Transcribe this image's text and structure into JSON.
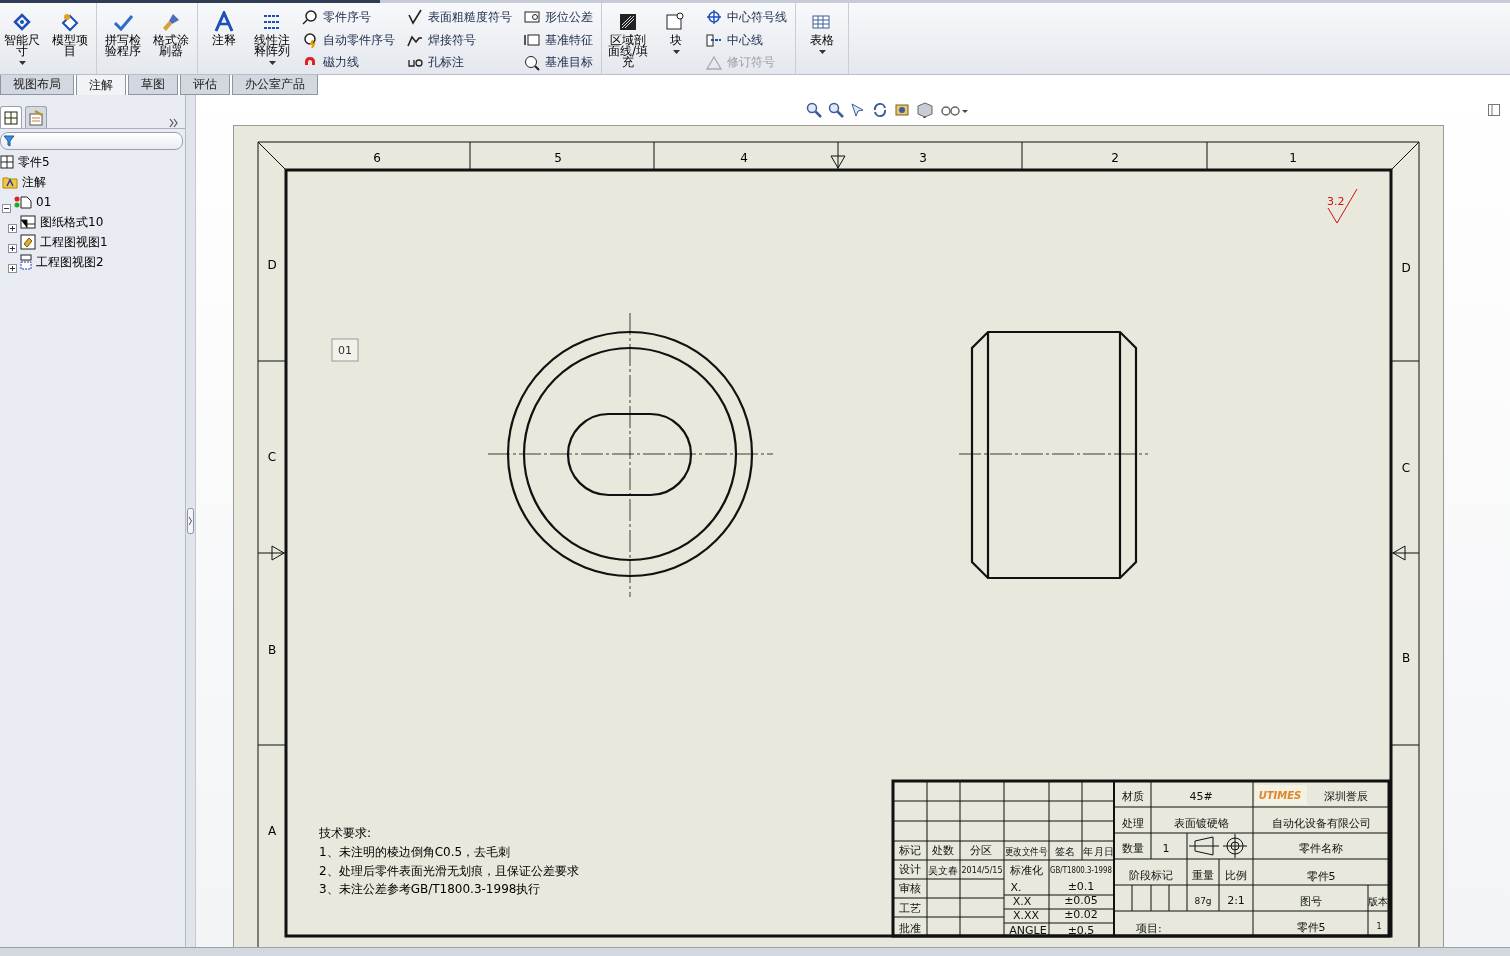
{
  "ribbon": [
    {
      "columns": [
        {
          "kind": "large",
          "label": "智能尺寸",
          "menu": true
        },
        {
          "kind": "large",
          "label": "模型项目",
          "menu": false
        }
      ]
    },
    {
      "columns": [
        {
          "kind": "large",
          "label": "拼写检验程序",
          "menu": false
        },
        {
          "kind": "large",
          "label": "格式涂刷器",
          "menu": false
        }
      ]
    },
    {
      "columns": [
        {
          "kind": "large",
          "label": "注释",
          "menu": false
        },
        {
          "kind": "large",
          "label": "线性注释阵列",
          "menu": true
        },
        {
          "kind": "stack",
          "buttons": [
            {
              "label": "零件序号",
              "disabled": false
            },
            {
              "label": "自动零件序号",
              "disabled": false
            },
            {
              "label": "磁力线",
              "disabled": false
            }
          ]
        },
        {
          "kind": "stack",
          "buttons": [
            {
              "label": "表面粗糙度符号",
              "disabled": false
            },
            {
              "label": "焊接符号",
              "disabled": false
            },
            {
              "label": "孔标注",
              "disabled": false
            }
          ]
        },
        {
          "kind": "stack",
          "buttons": [
            {
              "label": "形位公差",
              "disabled": false
            },
            {
              "label": "基准特征",
              "disabled": false
            },
            {
              "label": "基准目标",
              "disabled": false
            }
          ]
        }
      ]
    },
    {
      "columns": [
        {
          "kind": "large",
          "label": "区域剖面线/填充",
          "menu": false
        },
        {
          "kind": "large",
          "label": "块",
          "menu": true
        },
        {
          "kind": "stack",
          "buttons": [
            {
              "label": "中心符号线",
              "disabled": false
            },
            {
              "label": "中心线",
              "disabled": false
            },
            {
              "label": "修订符号",
              "disabled": true
            }
          ]
        }
      ]
    },
    {
      "columns": [
        {
          "kind": "large",
          "label": "表格",
          "menu": true
        }
      ]
    }
  ],
  "tabs": [
    {
      "label": "视图布局",
      "selected": false
    },
    {
      "label": "注解",
      "selected": true
    },
    {
      "label": "草图",
      "selected": false
    },
    {
      "label": "评估",
      "selected": false
    },
    {
      "label": "办公室产品",
      "selected": false
    }
  ],
  "panel_tabs": [
    {
      "kind": "tree",
      "selected": true
    },
    {
      "kind": "properties",
      "selected": false
    }
  ],
  "tree": [
    {
      "kind": "root",
      "label": "零件5",
      "children": [
        {
          "kind": "folder",
          "label": "注解"
        },
        {
          "kind": "sheet",
          "label": "01",
          "expanded": true,
          "children": [
            {
              "kind": "format",
              "label": "图纸格式10",
              "expanded": false
            },
            {
              "kind": "view",
              "label": "工程图视图1",
              "expanded": false
            },
            {
              "kind": "view2",
              "label": "工程图视图2",
              "expanded": false
            }
          ]
        }
      ]
    }
  ],
  "sheet": {
    "zone_columns": [
      "6",
      "5",
      "4",
      "3",
      "2",
      "1"
    ],
    "zone_rows_left": [
      "D",
      "C",
      "B",
      "A"
    ],
    "zone_rows_right": [
      "D",
      "C",
      "B"
    ],
    "balloon": "01",
    "roughness": "3.2",
    "notes": {
      "title": "技术要求:",
      "lines": [
        "1、未注明的棱边倒角C0.5，去毛刺",
        "2、处理后零件表面光滑无划痕，且保证公差要求",
        "3、未注公差参考GB/T1800.3-1998执行"
      ]
    },
    "title_block": [
      "标记",
      "处数",
      "分区",
      "更改文件号",
      "签名",
      "年",
      "月",
      "日",
      "设计",
      "吴文春",
      "2014/5/15",
      "标准化",
      "GB/T1800.3-1998",
      "审核",
      "X.",
      "±0.1",
      "工艺",
      "X.X",
      "±0.05",
      "批准",
      "X.XX",
      "±0.02",
      "ANGLE",
      "±0.5",
      "材质",
      "45#",
      "UTIMES",
      "深圳誉辰",
      "处理",
      "表面镀硬铬",
      "自动化设备有限公司",
      "数量",
      "1",
      "零件名称",
      "阶段标记",
      "重量",
      "比例",
      "零件5",
      "87g",
      "2:1",
      "图号",
      "版本",
      "项目:",
      "零件5",
      "1"
    ]
  }
}
